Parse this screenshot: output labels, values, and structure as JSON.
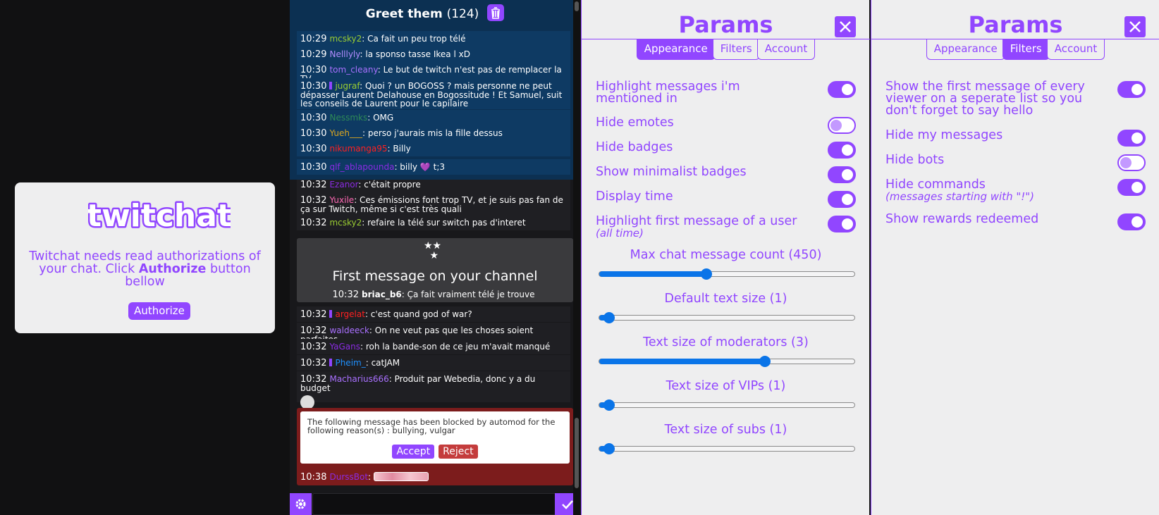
{
  "login": {
    "logo_text": "twitchat",
    "text_before": "Twitchat needs read authorizations of your chat. Click ",
    "text_bold": "Authorize",
    "text_after": " button bellow",
    "button": "Authorize"
  },
  "greet": {
    "title": "Greet them",
    "count": "(124)",
    "messages": [
      {
        "time": "10:29",
        "user": "mcsky2",
        "color": "#9acd32",
        "text": ": Ca fait un peu trop télé"
      },
      {
        "time": "10:29",
        "user": "Nelllyly",
        "color": "#b18cff",
        "text": ": la sponso tasse Ikea l xD"
      },
      {
        "time": "10:30",
        "user": "tom_cleany",
        "color": "#a970ff",
        "text": ": Le but de twitch n'est pas de remplacer la TV"
      },
      {
        "time": "10:30",
        "user": "jugraf",
        "color": "#9acd32",
        "text": ": Quoi ? un BOGOSS ? mais personne ne peut dépasser Laurent Delahouse en Bogossitude ! Et Samuel, suit les conseils de Laurent pour le capilaire"
      },
      {
        "time": "10:30",
        "user": "Nessmks",
        "color": "#2e8b57",
        "text": ": OMG"
      },
      {
        "time": "10:30",
        "user": "Yueh___",
        "color": "#daa520",
        "text": ": perso j'aurais mis la fille dessus"
      },
      {
        "time": "10:30",
        "user": "nikumanga95",
        "color": "#ff2020",
        "text": ": Billy"
      },
      {
        "time": "10:30",
        "user": "qlf_ablapounda",
        "color": "#8a2be2",
        "text": ": billy",
        "text2": " t;3"
      }
    ]
  },
  "chat": {
    "messages": [
      {
        "time": "10:32",
        "user": "Ezanor",
        "color": "#8a2be2",
        "text": ": c'était propre"
      },
      {
        "time": "10:32",
        "user": "Yuxile",
        "color": "#ff69b4",
        "text": ": Ces émissions font trop TV, et je suis pas fan de ça sur Twitch, même si c'est très quali"
      },
      {
        "time": "10:32",
        "user": "mcsky2",
        "color": "#9acd32",
        "text": ": refaire la télé sur switch pas d'interet"
      }
    ],
    "first_message": {
      "title": "First message on your channel",
      "time": "10:32",
      "user": "briac_b6",
      "color": "#ffffff",
      "text": ": Ça fait vraiment télé je trouve"
    },
    "messages2": [
      {
        "time": "10:32",
        "user": "argelat",
        "color": "#ff2020",
        "text": ": c'est quand god of war?"
      },
      {
        "time": "10:32",
        "user": "waldeeck",
        "color": "#a970ff",
        "text": ": On ne veut pas que les choses soient parfaites"
      },
      {
        "time": "10:32",
        "user": "YaGans",
        "color": "#8a2be2",
        "text": ": roh la bande-son de ce jeu m'avait manqué"
      },
      {
        "time": "10:32",
        "user": "Pheim_",
        "color": "#1e90ff",
        "text": ": catJAM"
      },
      {
        "time": "10:32",
        "user": "Macharius666",
        "color": "#a970ff",
        "text": ": Produit par Webedia, donc y a du budget"
      }
    ],
    "automod": {
      "text": "The following message has been blocked by automod for the following reason(s) : bullying, vulgar",
      "accept": "Accept",
      "reject": "Reject",
      "time": "10:38",
      "user": "DurssBot",
      "color": "#8a2be2"
    },
    "input_value": ""
  },
  "params_appearance": {
    "title": "Params",
    "tabs": [
      "Appearance",
      "Filters",
      "Account"
    ],
    "active_tab": "Appearance",
    "options": [
      {
        "label": "Highlight messages i'm mentioned in",
        "on": true
      },
      {
        "label": "Hide emotes",
        "on": false
      },
      {
        "label": "Hide badges",
        "on": true
      },
      {
        "label": "Show minimalist badges",
        "on": true
      },
      {
        "label": "Display time",
        "on": true
      },
      {
        "label": "Highlight first message of a user",
        "sub": "(all time)",
        "on": true
      }
    ],
    "sliders": [
      {
        "label": "Max chat message count (450)",
        "value": 450,
        "fraction": 0.42
      },
      {
        "label": "Default text size (1)",
        "value": 1,
        "fraction": 0.04
      },
      {
        "label": "Text size of moderators (3)",
        "value": 3,
        "fraction": 0.65
      },
      {
        "label": "Text size of VIPs (1)",
        "value": 1,
        "fraction": 0.04
      },
      {
        "label": "Text size of subs (1)",
        "value": 1,
        "fraction": 0.04
      }
    ]
  },
  "params_filters": {
    "title": "Params",
    "tabs": [
      "Appearance",
      "Filters",
      "Account"
    ],
    "active_tab": "Filters",
    "options": [
      {
        "label": "Show the first message of every viewer on a seperate list so you don't forget to say hello",
        "on": true
      },
      {
        "label": "Hide my messages",
        "on": true
      },
      {
        "label": "Hide bots",
        "on": false
      },
      {
        "label": "Hide commands",
        "sub": "(messages starting with \"!\")",
        "on": true
      },
      {
        "label": "Show rewards redeemed",
        "on": true
      }
    ]
  }
}
